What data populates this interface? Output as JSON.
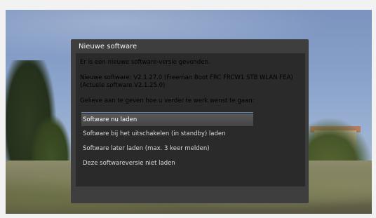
{
  "dialog": {
    "title": "Nieuwe software",
    "message": "Er is een nieuwe software-versie gevonden.",
    "new_software": "Nieuwe software: V2.1.27.0 (Freeman Boot FRC FRCW1 STB WLAN FEA)",
    "current_software": "(Actuele software V2.1.25.0)",
    "prompt": "Gelieve aan te geven hoe u verder te werk wenst te gaan:",
    "options": [
      {
        "label": "Software nu laden",
        "selected": true
      },
      {
        "label": "Software bij het uitschakelen (in standby) laden",
        "selected": false
      },
      {
        "label": "Software later laden (max. 3 keer melden)",
        "selected": false
      },
      {
        "label": "Deze softwareversie niet laden",
        "selected": false
      }
    ]
  }
}
